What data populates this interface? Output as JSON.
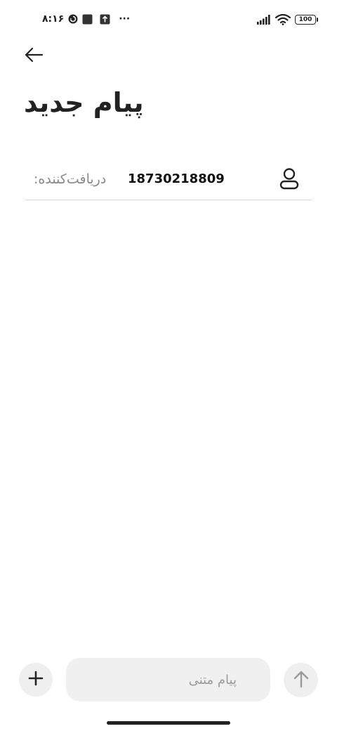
{
  "status_bar": {
    "time": "۸:۱۶",
    "more": "···",
    "battery": "100",
    "icons": [
      "sync-icon",
      "square-app-icon",
      "upload-icon",
      "signal-icon",
      "wifi-icon",
      "battery-icon"
    ]
  },
  "header": {
    "back_icon": "arrow-left-icon",
    "title": "پیام جدید"
  },
  "recipient": {
    "label": "دریافت‌کننده:",
    "number": "18730218809",
    "contact_icon": "person-icon"
  },
  "composer": {
    "add_icon": "plus-icon",
    "placeholder": "پیام متنی",
    "value": "",
    "send_icon": "arrow-up-icon"
  },
  "colors": {
    "background": "#ffffff",
    "text": "#222222",
    "muted": "#8a8a8a",
    "button_bg": "#efefef",
    "divider": "#d8d8d8",
    "send_icon_disabled": "#9a9a9a"
  }
}
